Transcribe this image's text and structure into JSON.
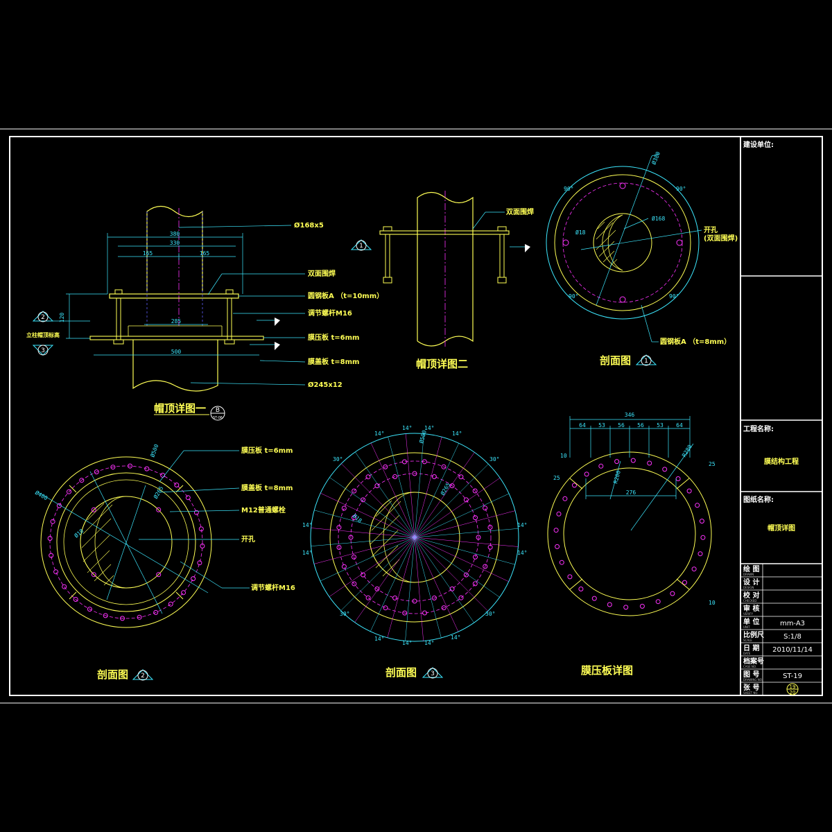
{
  "colors": {
    "background": "#000000",
    "frame": "#ffffff",
    "yellow": "#ffff55",
    "cyan": "#3de8ff",
    "magenta": "#ff33ff",
    "title_white": "#ffffff"
  },
  "detail1": {
    "title": "帽顶详图一",
    "ref": {
      "top": "B",
      "bottom": "ST-06"
    },
    "dims": {
      "d380": "380",
      "d330": "330",
      "d165a": "165",
      "d165b": "165",
      "d285": "285",
      "d500": "500",
      "d120": "120"
    },
    "labels": {
      "pipe_top": "Ø168x5",
      "weld": "双面围焊",
      "plate_a": "圆钢板A （t=10mm）",
      "bolt": "调节螺杆M16",
      "press_plate": "膜压板 t=6mm",
      "bottom_plate": "膜盖板 t=8mm",
      "pipe_bottom": "Ø245x12",
      "elev": "立柱帽顶标高"
    },
    "markers": {
      "m1": "2",
      "m2": "3"
    }
  },
  "detail2": {
    "title": "帽顶详图二",
    "labels": {
      "weld": "双面围焊"
    },
    "marker": "1"
  },
  "section1": {
    "title": "剖面图",
    "marker": "1",
    "labels": {
      "hole": "开孔",
      "hole_sub": "(双面围焊)",
      "plate_a": "圆钢板A （t=8mm）"
    },
    "dims": {
      "d380": "Ø380",
      "d168": "Ø168",
      "d18": "Ø18",
      "a1": "90°",
      "a2": "90°",
      "a3": "90°",
      "a4": "90°"
    }
  },
  "section2": {
    "title": "剖面图",
    "marker": "2",
    "labels": {
      "press_plate": "膜压板 t=6mm",
      "bottom_plate": "膜盖板 t=8mm",
      "bolt_m12": "M12普通螺栓",
      "hole": "开孔",
      "bolt_m16": "调节螺杆M16"
    },
    "dims": {
      "d500": "Ø500",
      "d400": "Ø400",
      "d265": "Ø265",
      "d18": "Ø18"
    }
  },
  "section3": {
    "title": "剖面图",
    "marker": "3",
    "dims": {
      "d500": "Ø500",
      "d265": "Ø265",
      "d18": "Ø18",
      "a14": "14°",
      "a30": "30°"
    }
  },
  "press_plate_detail": {
    "title": "膜压板详图",
    "dims": {
      "total": "346",
      "s1": "64",
      "s2": "53",
      "s3": "56",
      "s4": "56",
      "s5": "53",
      "s6": "64",
      "r280": "R280",
      "r200": "R200",
      "w276": "276",
      "g10a": "10",
      "g25a": "25",
      "g10b": "10",
      "g25b": "25"
    }
  },
  "title_block": {
    "client_label": "建设单位:",
    "project_label": "工程名称:",
    "project_name": "膜结构工程",
    "drawing_label": "图纸名称:",
    "drawing_name": "帽顶详图",
    "rows": [
      {
        "label": "绘 图",
        "sub": "DRAWN",
        "value": ""
      },
      {
        "label": "设 计",
        "sub": "DESIGN",
        "value": ""
      },
      {
        "label": "校 对",
        "sub": "CHECKED",
        "value": ""
      },
      {
        "label": "审 核",
        "sub": "VERIFY",
        "value": ""
      },
      {
        "label": "单 位",
        "sub": "UNIT",
        "value": "mm-A3"
      },
      {
        "label": "比例尺",
        "sub": "SCALE",
        "value": "S:1/8"
      },
      {
        "label": "日 期",
        "sub": "DATE",
        "value": "2010/11/14"
      },
      {
        "label": "档案号",
        "sub": "CASE NO.",
        "value": ""
      },
      {
        "label": "图 号",
        "sub": "DRAWING NO.",
        "value": "ST-19"
      },
      {
        "label": "张 号",
        "sub": "SHEET NO.",
        "value": ""
      }
    ],
    "sheet": {
      "num": "19",
      "total": "20"
    }
  }
}
